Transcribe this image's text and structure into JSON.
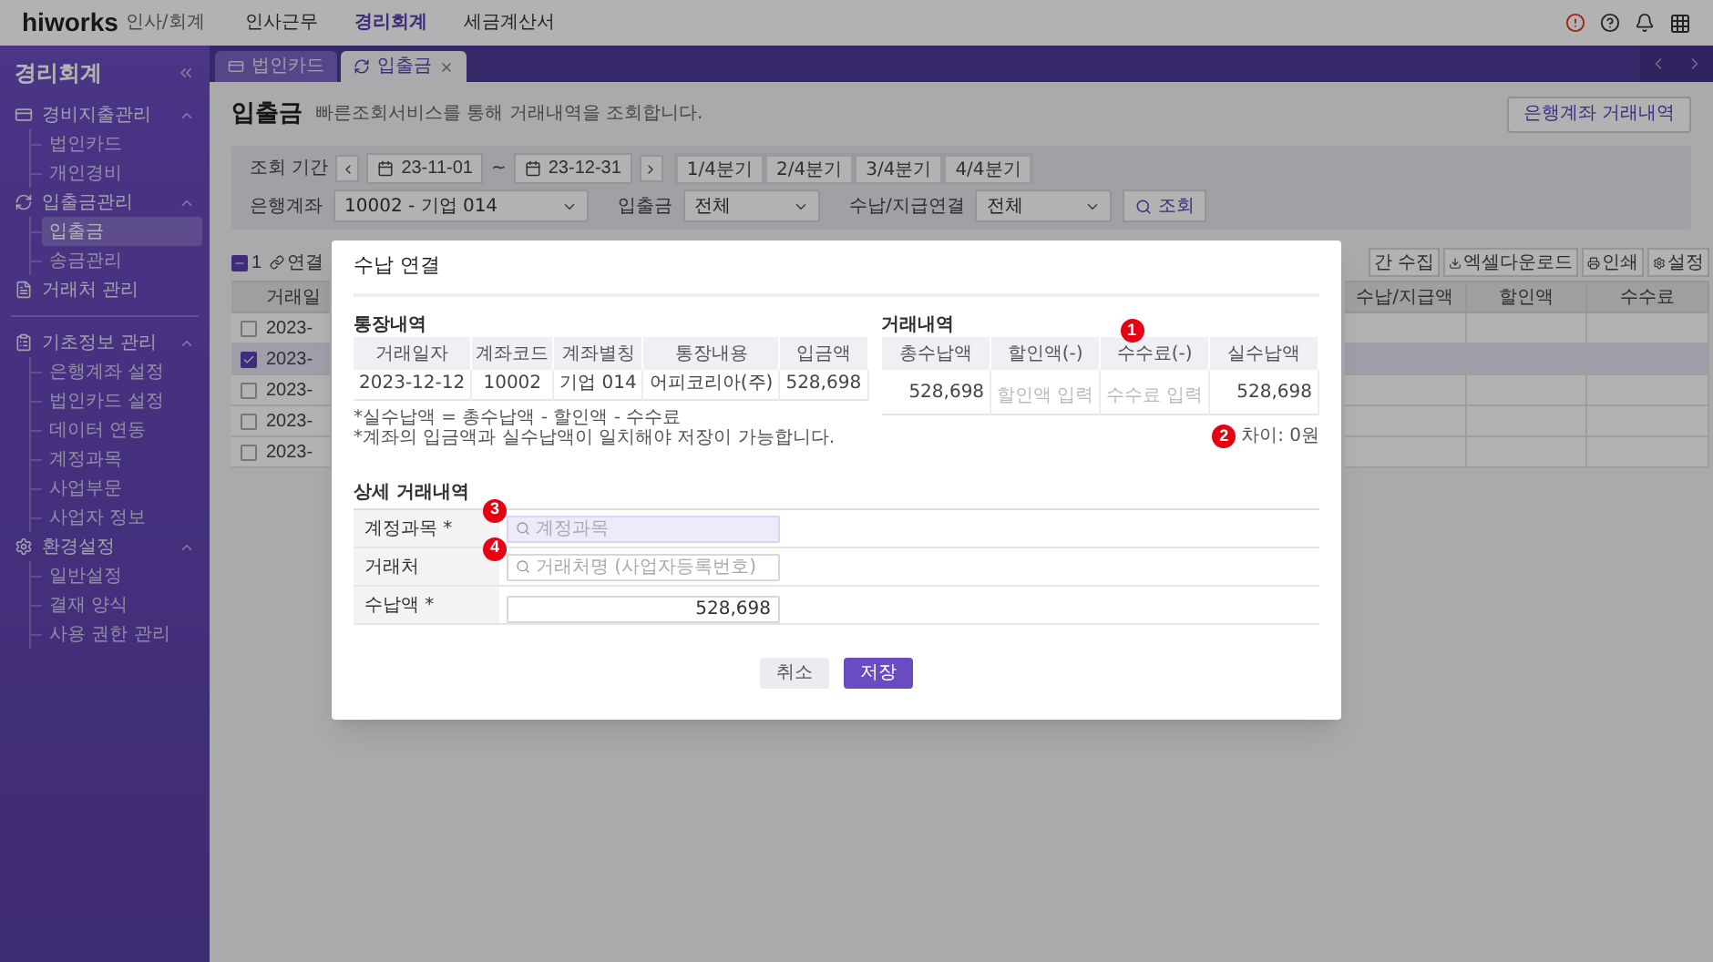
{
  "header": {
    "brand": "hiworks",
    "brand_sub": "인사/회계",
    "nav": [
      {
        "label": "인사근무",
        "selected": false
      },
      {
        "label": "경리회계",
        "selected": true
      },
      {
        "label": "세금계산서",
        "selected": false
      }
    ]
  },
  "sidebar": {
    "title": "경리회계",
    "groups": [
      {
        "kind": "card",
        "label": "경비지출관리",
        "expanded": true,
        "children": [
          {
            "label": "법인카드",
            "selected": false
          },
          {
            "label": "개인경비",
            "selected": false
          }
        ]
      },
      {
        "kind": "exchange",
        "label": "입출금관리",
        "expanded": true,
        "children": [
          {
            "label": "입출금",
            "selected": true
          },
          {
            "label": "송금관리",
            "selected": false
          }
        ]
      },
      {
        "kind": "document",
        "label": "거래처 관리"
      },
      {
        "kind": "info",
        "label": "기초정보 관리",
        "expanded": true,
        "divider": true,
        "children": [
          {
            "label": "은행계좌 설정",
            "selected": false
          },
          {
            "label": "법인카드 설정",
            "selected": false
          },
          {
            "label": "데이터 연동",
            "selected": false
          },
          {
            "label": "계정과목",
            "selected": false
          },
          {
            "label": "사업부문",
            "selected": false
          },
          {
            "label": "사업자 정보",
            "selected": false
          }
        ]
      },
      {
        "kind": "gear",
        "label": "환경설정",
        "expanded": true,
        "children": [
          {
            "label": "일반설정",
            "selected": false
          },
          {
            "label": "결재 양식",
            "selected": false
          },
          {
            "label": "사용 권한 관리",
            "selected": false
          }
        ]
      }
    ]
  },
  "tabs": [
    {
      "kind": "card",
      "label": "법인카드",
      "selected": false,
      "closable": false
    },
    {
      "kind": "exchange",
      "label": "입출금",
      "selected": true,
      "closable": true
    }
  ],
  "page": {
    "title": "입출금",
    "subtitle": "빠른조회서비스를 통해 거래내역을 조회합니다.",
    "top_button": "은행계좌 거래내역"
  },
  "filters": {
    "period_label": "조회 기간",
    "start": "23-11-01",
    "separator": "~",
    "end": "23-12-31",
    "quarters": [
      "1/4분기",
      "2/4분기",
      "3/4분기",
      "4/4분기"
    ],
    "account_label": "은행계좌",
    "account": "10002 - 기업 014",
    "io_label": "입출금",
    "io": "전체",
    "link_label": "수납/지급연결",
    "link": "전체",
    "search": "조회"
  },
  "toolbar": {
    "indeterminate": true,
    "count": "1",
    "link": "연결",
    "collect": "간 수집",
    "excel": "엑셀다운로드",
    "print": "인쇄",
    "settings": "설정"
  },
  "table": {
    "column_1": "거래일",
    "right_columns": [
      "수납/지급액",
      "할인액",
      "수수료"
    ],
    "rows": [
      {
        "date": "2023-",
        "checked": false
      },
      {
        "date": "2023-",
        "checked": true
      },
      {
        "date": "2023-",
        "checked": false
      },
      {
        "date": "2023-",
        "checked": false
      },
      {
        "date": "2023-",
        "checked": false
      }
    ]
  },
  "modal": {
    "title": "수납 연결",
    "bank": {
      "title": "통장내역",
      "columns": [
        "거래일자",
        "계좌코드",
        "계좌별칭",
        "통장내용",
        "입금액"
      ],
      "row": [
        "2023-12-12",
        "10002",
        "기업 014",
        "어피코리아(주)",
        "528,698"
      ]
    },
    "notes": [
      "*실수납액 = 총수납액 - 할인액 - 수수료",
      "*계좌의 입금액과 실수납액이 일치해야 저장이 가능합니다."
    ],
    "transaction": {
      "title": "거래내역",
      "marker": "1",
      "columns": [
        "총수납액",
        "할인액(-)",
        "수수료(-)",
        "실수납액"
      ],
      "cells": [
        {
          "kind": "value",
          "text": "528,698"
        },
        {
          "kind": "input",
          "placeholder": "할인액 입력"
        },
        {
          "kind": "input",
          "placeholder": "수수료 입력"
        },
        {
          "kind": "value",
          "text": "528,698"
        }
      ],
      "difference_marker": "2",
      "difference": "차이: 0원"
    },
    "detail": {
      "title": "상세 거래내역",
      "rows": [
        {
          "label": "계정과목 *",
          "kind": "search",
          "placeholder": "계정과목",
          "highlighted": true,
          "marker": "3"
        },
        {
          "label": "거래처",
          "kind": "search",
          "placeholder": "거래처명 (사업자등록번호)",
          "highlighted": false,
          "marker": "4"
        },
        {
          "label": "수납액 *",
          "kind": "amount",
          "value": "528,698"
        }
      ]
    },
    "buttons": [
      {
        "label": "취소",
        "kind": "secondary"
      },
      {
        "label": "저장",
        "kind": "primary"
      }
    ]
  }
}
